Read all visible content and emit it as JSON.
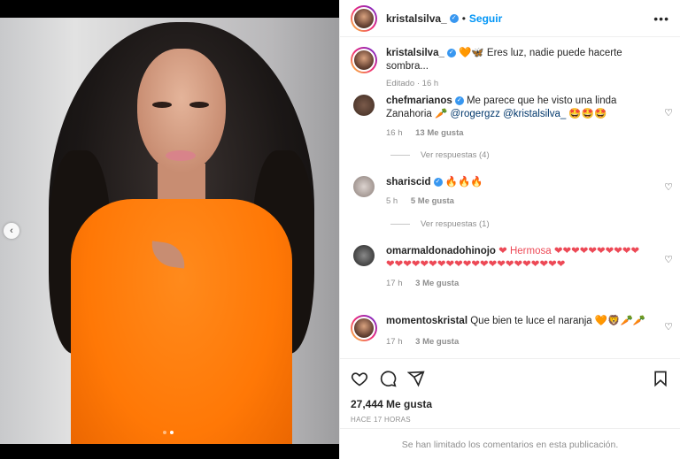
{
  "header": {
    "username": "kristalsilva_",
    "separator": "•",
    "follow_label": "Seguir",
    "more_label": "•••"
  },
  "caption": {
    "username": "kristalsilva_",
    "text": "🧡🦋 Eres luz, nadie puede hacerte sombra...",
    "meta": "Editado · 16 h"
  },
  "comments": [
    {
      "username": "chefmarianos",
      "verified": true,
      "text_before": " Me parece que he visto una linda Zanahoria 🥕 ",
      "mention1": "@rogergzz",
      "mention2": "@kristalsilva_",
      "text_after": " 🤩🤩🤩",
      "time": "16 h",
      "likes": "13 Me gusta",
      "replies": "Ver respuestas (4)"
    },
    {
      "username": "shariscid",
      "verified": true,
      "text": " 🔥🔥🔥",
      "time": "5 h",
      "likes": "5 Me gusta",
      "replies": "Ver respuestas (1)"
    },
    {
      "username": "omarmaldonadohinojo",
      "text": " ❤ Hermosa ❤❤❤❤❤❤❤❤❤❤❤❤❤❤❤❤❤❤❤❤❤❤❤❤❤❤❤❤❤❤❤",
      "time": "17 h",
      "likes": "3 Me gusta"
    },
    {
      "username": "momentoskristal",
      "text": " Que bien te luce el naranja 🧡🦁🥕🥕",
      "time": "17 h",
      "likes": "3 Me gusta"
    }
  ],
  "actions": {
    "likes": "27,444 Me gusta",
    "ago": "HACE 17 HORAS"
  },
  "footer": {
    "limited": "Se han limitado los comentarios en esta publicación."
  },
  "icons": {
    "like": "heart-outline-icon",
    "comment": "speech-bubble-icon",
    "share": "paper-plane-icon",
    "save": "bookmark-icon",
    "verified": "verified-badge-icon",
    "prev": "chevron-left-icon"
  },
  "colors": {
    "accent": "#0095f6",
    "verified": "#3897f0",
    "muted": "#8e8e8e",
    "heart_red": "#ed4956",
    "dress_orange": "#ff7806"
  },
  "carousel": {
    "current": 2,
    "total": 2
  }
}
